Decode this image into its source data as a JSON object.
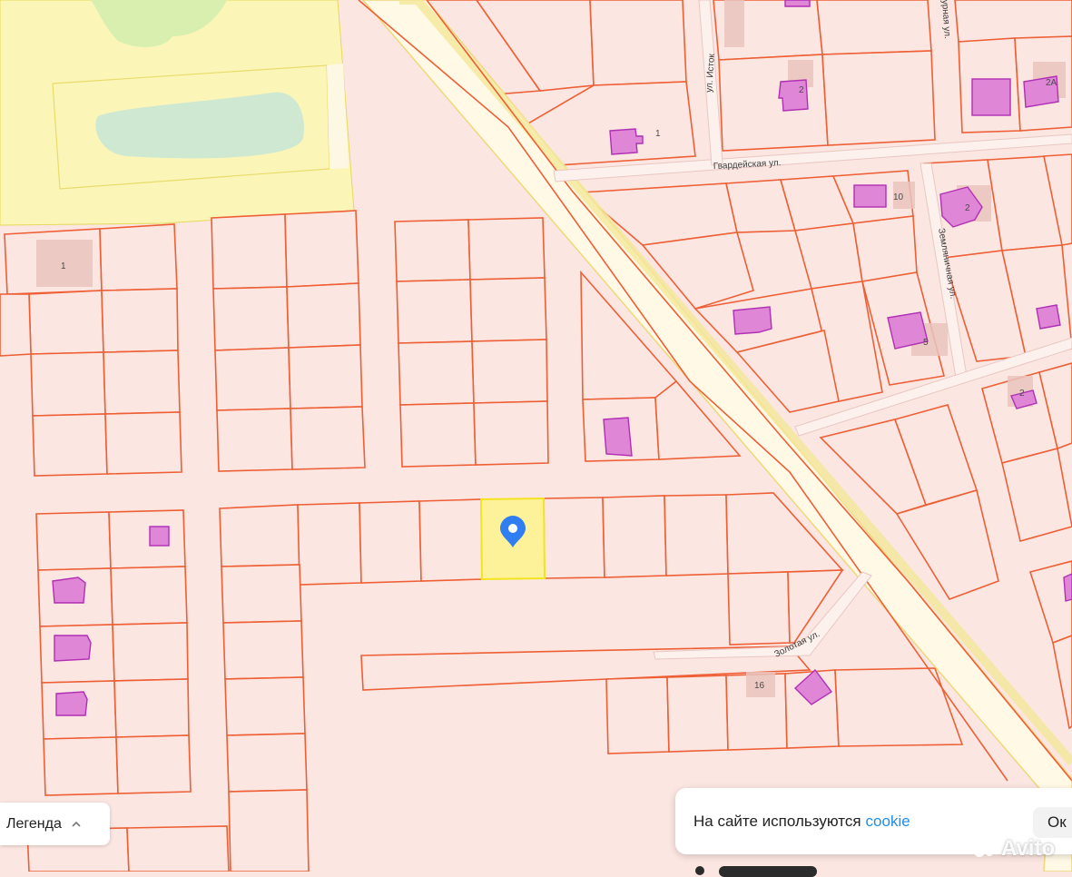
{
  "map": {
    "colors": {
      "background": "#fbe6e1",
      "lot_border": "#ee5f35",
      "building_fill": "#df86d6",
      "building_border": "#b12fb5",
      "park_fill": "#fbf6b8",
      "water_fill": "#cfe8d2",
      "highway_fill": "#fff9e6",
      "selected_fill": "#fdf29a",
      "selected_border": "#f4e41f",
      "marker": "#2f7ff2"
    },
    "streets": {
      "istok": "ул. Исток",
      "gvardeyskaya": "Гвардейская ул.",
      "zemlyanichnaya": "Земляничная ул.",
      "zolotaya": "Золотая ул.",
      "partial": "урная ул."
    },
    "house_numbers": {
      "n1_a": "1",
      "n1_b": "1",
      "n2a": "2А",
      "n10": "10",
      "n2_a": "2",
      "n5": "5",
      "n2_b": "2",
      "n16": "16",
      "n2_c": "2"
    },
    "marker_icon": "location-pin-icon"
  },
  "legend": {
    "label": "Легенда",
    "icon": "chevron-up-icon"
  },
  "cookie_banner": {
    "text": "На сайте используются",
    "link": "cookie",
    "ok_label": "Ок"
  },
  "watermark": {
    "text": "Avito"
  }
}
